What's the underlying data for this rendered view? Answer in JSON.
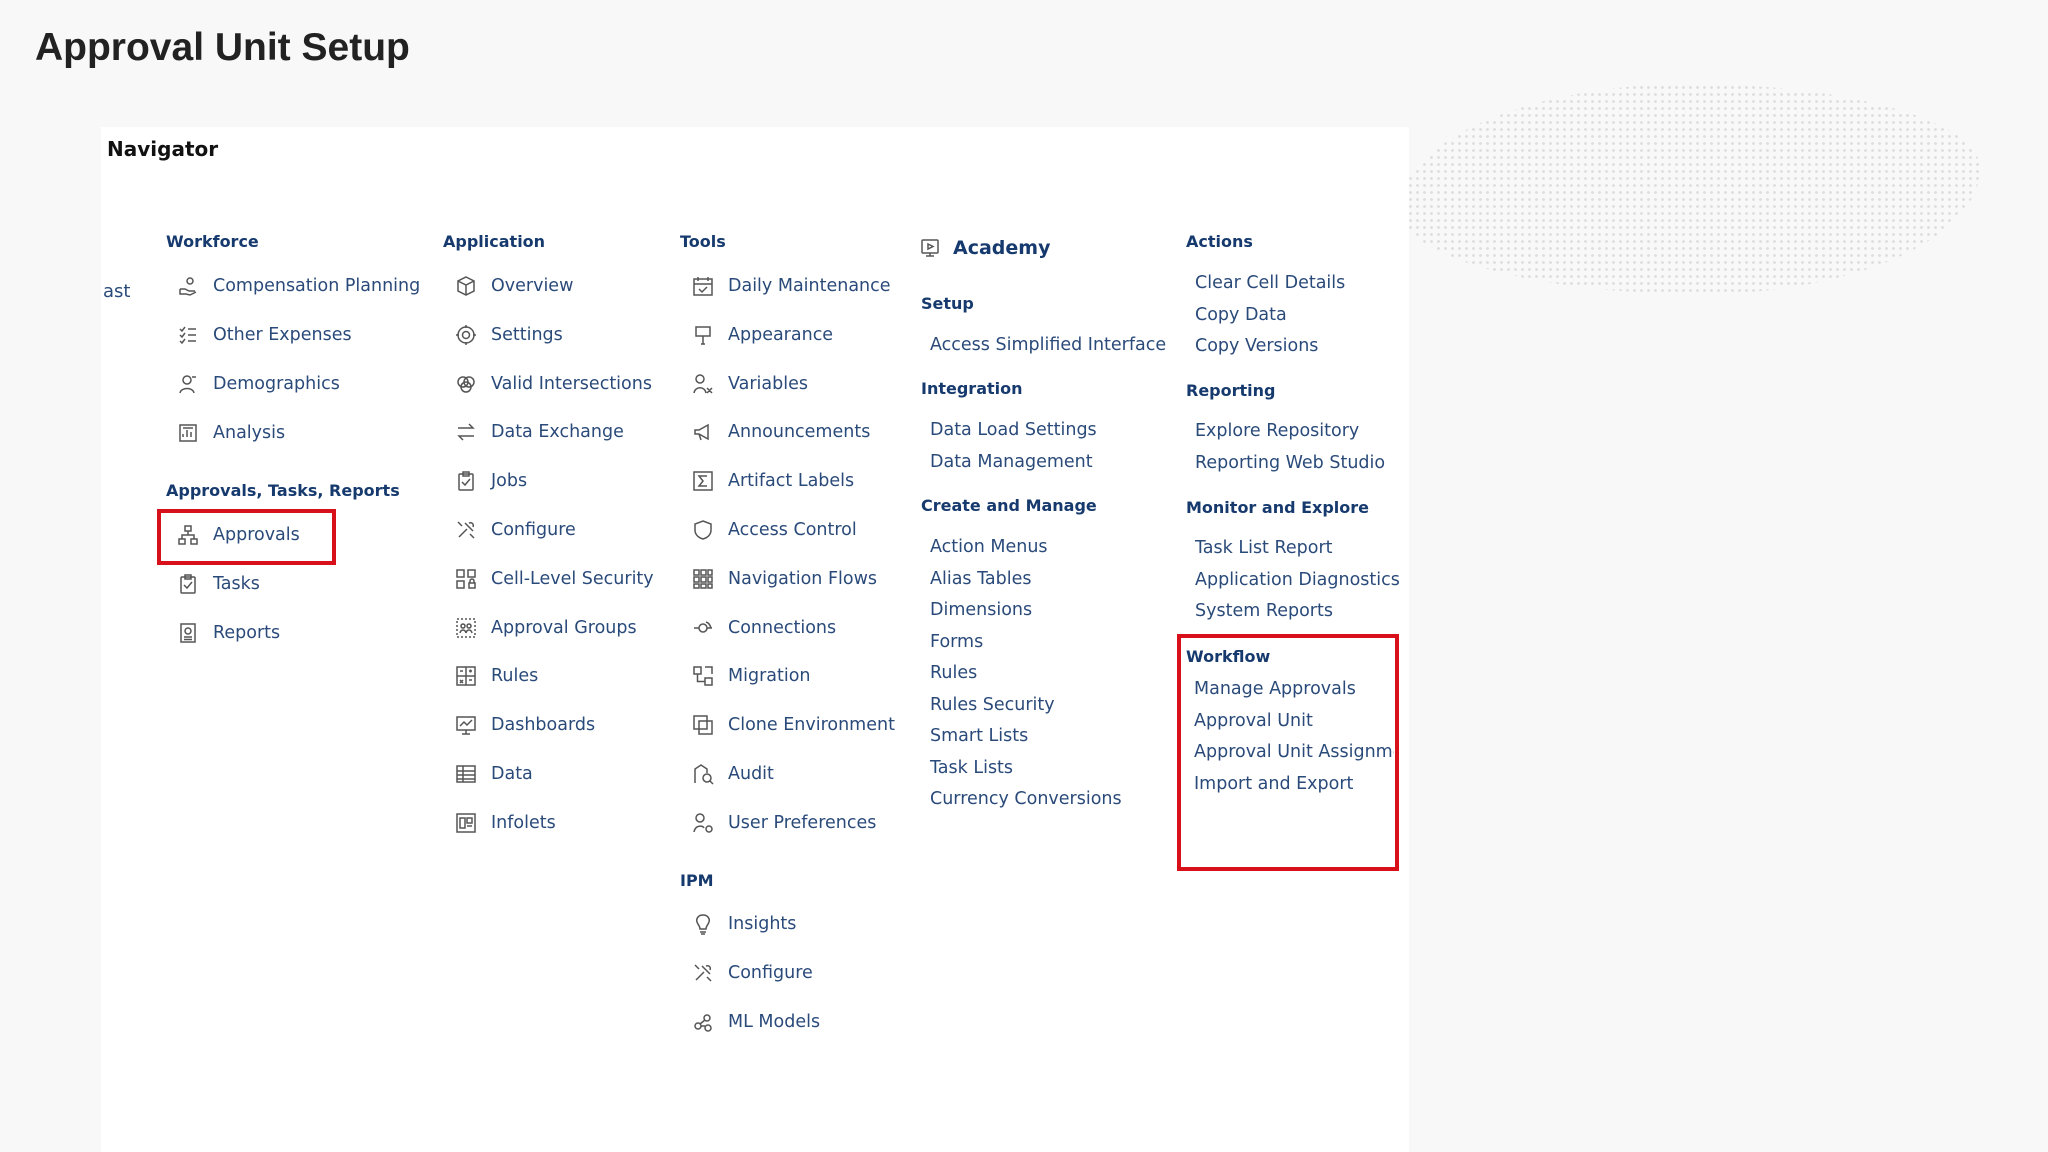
{
  "slide": {
    "title": "Approval Unit Setup"
  },
  "navigator": {
    "title": "Navigator",
    "clipped_text": "ast",
    "workforce": {
      "heading": "Workforce",
      "items": [
        {
          "label": "Compensation Planning",
          "icon": "hand-coins-icon"
        },
        {
          "label": "Other Expenses",
          "icon": "checklist-icon"
        },
        {
          "label": "Demographics",
          "icon": "person-icon"
        },
        {
          "label": "Analysis",
          "icon": "analysis-icon"
        }
      ]
    },
    "approvals_tasks_reports": {
      "heading": "Approvals, Tasks, Reports",
      "items": [
        {
          "label": "Approvals",
          "icon": "hierarchy-icon"
        },
        {
          "label": "Tasks",
          "icon": "clipboard-icon"
        },
        {
          "label": "Reports",
          "icon": "report-icon"
        }
      ]
    },
    "application": {
      "heading": "Application",
      "items": [
        {
          "label": "Overview",
          "icon": "cube-icon"
        },
        {
          "label": "Settings",
          "icon": "gear-icon"
        },
        {
          "label": "Valid Intersections",
          "icon": "intersect-icon"
        },
        {
          "label": "Data Exchange",
          "icon": "exchange-icon"
        },
        {
          "label": "Jobs",
          "icon": "clipboard-icon"
        },
        {
          "label": "Configure",
          "icon": "tools-icon"
        },
        {
          "label": "Cell-Level Security",
          "icon": "grid-lock-icon"
        },
        {
          "label": "Approval Groups",
          "icon": "group-icon"
        },
        {
          "label": "Rules",
          "icon": "rules-icon"
        },
        {
          "label": "Dashboards",
          "icon": "dashboard-icon"
        },
        {
          "label": "Data",
          "icon": "table-icon"
        },
        {
          "label": "Infolets",
          "icon": "infolet-icon"
        }
      ]
    },
    "tools": {
      "heading": "Tools",
      "items": [
        {
          "label": "Daily Maintenance",
          "icon": "calendar-icon"
        },
        {
          "label": "Appearance",
          "icon": "paint-icon"
        },
        {
          "label": "Variables",
          "icon": "variables-icon"
        },
        {
          "label": "Announcements",
          "icon": "megaphone-icon"
        },
        {
          "label": "Artifact Labels",
          "icon": "sigma-icon"
        },
        {
          "label": "Access Control",
          "icon": "shield-icon"
        },
        {
          "label": "Navigation Flows",
          "icon": "flow-grid-icon"
        },
        {
          "label": "Connections",
          "icon": "connection-icon"
        },
        {
          "label": "Migration",
          "icon": "migration-icon"
        },
        {
          "label": "Clone Environment",
          "icon": "clone-icon"
        },
        {
          "label": "Audit",
          "icon": "audit-icon"
        },
        {
          "label": "User Preferences",
          "icon": "user-gear-icon"
        }
      ]
    },
    "ipm": {
      "heading": "IPM",
      "items": [
        {
          "label": "Insights",
          "icon": "bulb-icon"
        },
        {
          "label": "Configure",
          "icon": "tools-icon"
        },
        {
          "label": "ML Models",
          "icon": "ml-icon"
        }
      ]
    },
    "academy": {
      "label": "Academy",
      "icon": "academy-icon"
    },
    "setup": {
      "heading": "Setup",
      "items": [
        "Access Simplified Interface"
      ]
    },
    "integration": {
      "heading": "Integration",
      "items": [
        "Data Load Settings",
        "Data Management"
      ]
    },
    "create_and_manage": {
      "heading": "Create and Manage",
      "items": [
        "Action Menus",
        "Alias Tables",
        "Dimensions",
        "Forms",
        "Rules",
        "Rules Security",
        "Smart Lists",
        "Task Lists",
        "Currency Conversions"
      ]
    },
    "actions": {
      "heading": "Actions",
      "items": [
        "Clear Cell Details",
        "Copy Data",
        "Copy Versions"
      ]
    },
    "reporting": {
      "heading": "Reporting",
      "items": [
        "Explore Repository",
        "Reporting Web Studio"
      ]
    },
    "monitor_and_explore": {
      "heading": "Monitor and Explore",
      "items": [
        "Task List Report",
        "Application Diagnostics",
        "System Reports"
      ]
    },
    "workflow": {
      "heading": "Workflow",
      "items": [
        "Manage Approvals",
        "Approval Unit",
        "Approval Unit Assignment",
        "Import and Export"
      ]
    },
    "highlight_color": "#d8101a"
  }
}
